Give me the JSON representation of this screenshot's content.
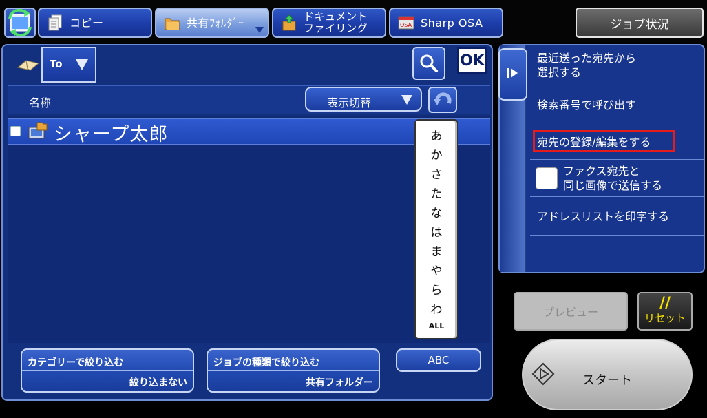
{
  "top_tabs": [
    {
      "label": "コピー",
      "icon": "copy-icon"
    },
    {
      "label": "共有ﾌｫﾙﾀﾞｰ",
      "icon": "shared-folder-icon"
    },
    {
      "label_line1": "ドキュメント",
      "label_line2": "ファイリング",
      "icon": "document-filing-icon"
    },
    {
      "label": "Sharp OSA",
      "icon": "osa-icon"
    }
  ],
  "job_status_label": "ジョブ状況",
  "address": {
    "to_label": "To",
    "ok_label": "OK"
  },
  "table": {
    "name_header": "名称",
    "view_switch_label": "表示切替",
    "rows": [
      {
        "name": "シャープ太郎"
      }
    ]
  },
  "kana_index": [
    "あ",
    "か",
    "さ",
    "た",
    "な",
    "は",
    "ま",
    "や",
    "ら",
    "わ",
    "ALL"
  ],
  "filters": {
    "category": {
      "label": "カテゴリーで絞り込む",
      "value": "絞り込まない"
    },
    "job_type": {
      "label": "ジョブの種類で絞り込む",
      "value": "共有フォルダー"
    },
    "abc_label": "ABC"
  },
  "side_menu": {
    "recent_line1": "最近送った宛先から",
    "recent_line2": "選択する",
    "search_number": "検索番号で呼び出す",
    "register_edit": "宛先の登録/編集をする",
    "fax_line1": "ファクス宛先と",
    "fax_line2": "同じ画像で送信する",
    "print_list": "アドレスリストを印字する"
  },
  "actions": {
    "preview_label": "プレビュー",
    "reset_slash": "//",
    "reset_label": "リセット",
    "start_label": "スタート"
  },
  "colors": {
    "panel_blue": "#13307e",
    "accent_red": "#e61c1c",
    "reset_yellow": "#f5e100"
  }
}
